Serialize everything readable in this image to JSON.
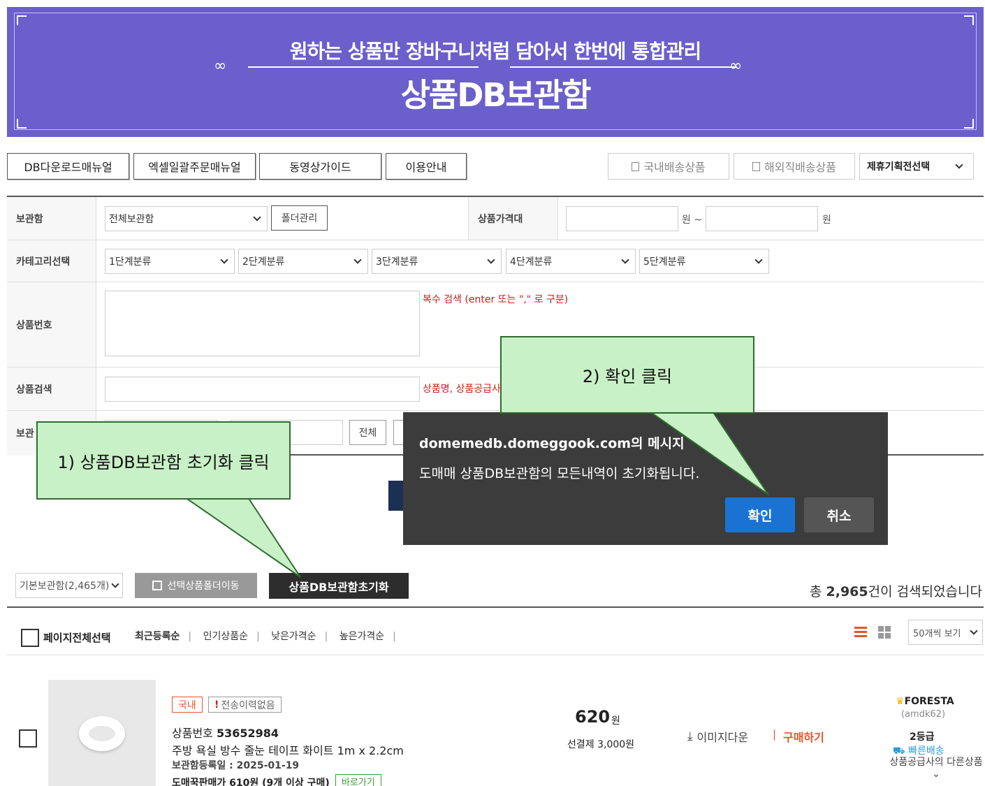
{
  "banner": {
    "subtitle": "원하는 상품만 장바구니처럼 담아서 한번에 통합관리",
    "title": "상품DB보관함",
    "ornament": "∞"
  },
  "top_buttons": [
    "DB다운로드매뉴얼",
    "엑셀일괄주문매뉴얼",
    "동영상가이드",
    "이용안내"
  ],
  "right_buttons": [
    "국내배송상품",
    "해외직배송상품"
  ],
  "plan_select": "제휴기획전선택",
  "form": {
    "storage_label": "보관함",
    "storage_value": "전체보관함",
    "folder_btn": "폴더관리",
    "price_label": "상품가격대",
    "won1": "원 ~",
    "won2": "원",
    "category_label": "카테고리선택",
    "categories": [
      "1단계분류",
      "2단계분류",
      "3단계분류",
      "4단계분류",
      "5단계분류"
    ],
    "product_no_label": "상품번호",
    "multi_search_hint": "복수 검색 (enter 또는 \",\" 로 구분)",
    "product_search_label": "상품검색",
    "product_search_hint": "상품명, 상품공급사",
    "storage_date_label": "보관",
    "all_btn": "전체"
  },
  "dialog": {
    "title": "domemedb.domeggook.com의 메시지",
    "message": "도매매 상품DB보관함의 모든내역이 초기화됩니다.",
    "ok": "확인",
    "cancel": "취소"
  },
  "callouts": {
    "step1": "1) 상품DB보관함 초기화 클릭",
    "step2": "2) 확인 클릭"
  },
  "toolbar": {
    "store_select": "기본보관함(2,465개)",
    "move_btn": "선택상품폴더이동",
    "reset_btn": "상품DB보관함초기화",
    "count_prefix": "총 ",
    "count": "2,965",
    "count_suffix": "건이 검색되었습니다"
  },
  "sort": {
    "select_all": "페이지전체선택",
    "options": [
      "최근등록순",
      "인기상품순",
      "낮은가격순",
      "높은가격순"
    ],
    "per_page": "50개씩 보기"
  },
  "product": {
    "badge_domestic": "국내",
    "badge_history": "전송이력없음",
    "number_label": "상품번호",
    "number": "53652984",
    "name": "주방 욕실 방수 줄눈 테이프 화이트 1m x 2.2cm",
    "reg_date": "보관함등록일 : 2025-01-19",
    "wholesale": "도매꾹판매가 610원 (9개 이상 구매)",
    "go_btn": "바로가기",
    "price": "620",
    "price_unit": "원",
    "shipping": "선결제 3,000원",
    "img_down": "이미지다운",
    "buy": "구매하기",
    "seller": "FORESTA",
    "seller_id": "(amdk62)",
    "grade": "2등급",
    "fast": "빠른배송",
    "other": "상품공급사의 다른상품"
  },
  "colors": {
    "banner": "#6a5fcb",
    "dialog": "#3c3c3c",
    "ok_button": "#1a73d2",
    "callout": "#c9f1c7",
    "accent_red": "#d01a1a"
  }
}
